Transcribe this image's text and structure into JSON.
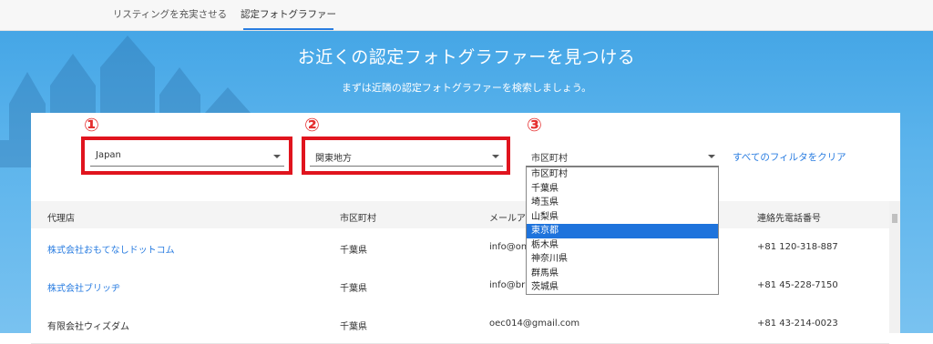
{
  "nav": {
    "tabs": [
      {
        "label": "リスティングを充実させる"
      },
      {
        "label": "認定フォトグラファー"
      }
    ]
  },
  "hero": {
    "title": "お近くの認定フォトグラファーを見つける",
    "subtitle": "まずは近隣の認定フォトグラファーを検索しましょう。"
  },
  "markers": [
    "①",
    "②",
    "③"
  ],
  "filters": {
    "country": "Japan",
    "region": "関東地方",
    "city": "市区町村",
    "clear_label": "すべてのフィルタをクリア"
  },
  "city_dropdown": {
    "options": [
      "市区町村",
      "千葉県",
      "埼玉県",
      "山梨県",
      "東京都",
      "栃木県",
      "神奈川県",
      "群馬県",
      "茨城県"
    ],
    "highlighted": "東京都"
  },
  "table": {
    "headers": [
      "代理店",
      "市区町村",
      "メールア",
      "連絡先電話番号"
    ],
    "rows": [
      {
        "agency": "株式会社おもてなしドットコム",
        "city": "千葉県",
        "email": "info@om",
        "phone": "+81 120-318-887"
      },
      {
        "agency": "株式会社ブリッヂ",
        "city": "千葉県",
        "email": "info@brid",
        "phone": "+81 45-228-7150"
      },
      {
        "agency": "有限会社ウィズダム",
        "city": "千葉県",
        "email": "oec014@gmail.com",
        "phone": "+81 43-214-0023"
      }
    ]
  },
  "colors": {
    "accent": "#2a7de1",
    "hero_blue": "#45a6e6",
    "highlight_red": "#e0141e",
    "selected_option": "#1e73dc"
  }
}
